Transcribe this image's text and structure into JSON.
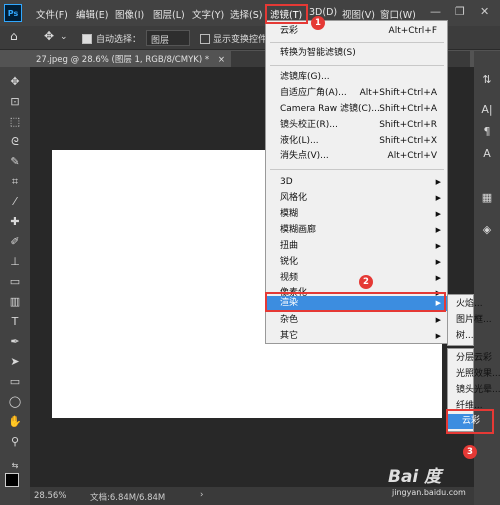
{
  "menubar": {
    "logo": "Ps",
    "items": [
      "文件(F)",
      "编辑(E)",
      "图像(I)",
      "图层(L)",
      "文字(Y)",
      "选择(S)",
      "滤镜(T)",
      "3D(D)",
      "视图(V)",
      "窗口(W)"
    ],
    "win_minimize": "—",
    "win_restore": "❐",
    "win_close": "✕"
  },
  "optionsbar": {
    "auto_select_label": "自动选择：",
    "auto_select_checked": true,
    "layer_dropdown": "图层",
    "show_transform_label": "显示变换控件",
    "show_transform_checked": false
  },
  "document": {
    "tab_title": "27.jpeg @ 28.6% (图层 1, RGB/8/CMYK) *",
    "tab_close": "×"
  },
  "statusbar": {
    "zoom": "28.56%",
    "doc_info": "文档:6.84M/6.84M",
    "arrow": "›"
  },
  "filter_menu": {
    "items": [
      {
        "label": "云彩",
        "shortcut": "Alt+Ctrl+F"
      },
      {
        "label": "转换为智能滤镜(S)",
        "shortcut": ""
      },
      {
        "label": "滤镜库(G)...",
        "shortcut": ""
      },
      {
        "label": "自适应广角(A)...",
        "shortcut": "Alt+Shift+Ctrl+A"
      },
      {
        "label": "Camera Raw 滤镜(C)...",
        "shortcut": "Shift+Ctrl+A"
      },
      {
        "label": "镜头校正(R)...",
        "shortcut": "Shift+Ctrl+R"
      },
      {
        "label": "液化(L)...",
        "shortcut": "Shift+Ctrl+X"
      },
      {
        "label": "消失点(V)...",
        "shortcut": "Alt+Ctrl+V"
      },
      {
        "label": "3D",
        "shortcut": ""
      },
      {
        "label": "风格化",
        "shortcut": ""
      },
      {
        "label": "模糊",
        "shortcut": ""
      },
      {
        "label": "模糊画廊",
        "shortcut": ""
      },
      {
        "label": "扭曲",
        "shortcut": ""
      },
      {
        "label": "锐化",
        "shortcut": ""
      },
      {
        "label": "视频",
        "shortcut": ""
      },
      {
        "label": "像素化",
        "shortcut": ""
      },
      {
        "label": "渲染",
        "shortcut": ""
      },
      {
        "label": "杂色",
        "shortcut": ""
      },
      {
        "label": "其它",
        "shortcut": ""
      }
    ]
  },
  "render_submenu_a": {
    "items": [
      "火焰...",
      "图片框...",
      "树..."
    ]
  },
  "render_submenu_b": {
    "items": [
      "分层云彩",
      "光照效果...",
      "镜头光晕...",
      "纤维...",
      "云彩"
    ]
  },
  "annotations": {
    "badge1": "1",
    "badge2": "2",
    "badge3": "3"
  },
  "watermark": {
    "logo": "Bai 度",
    "url": "jingyan.baidu.com"
  }
}
